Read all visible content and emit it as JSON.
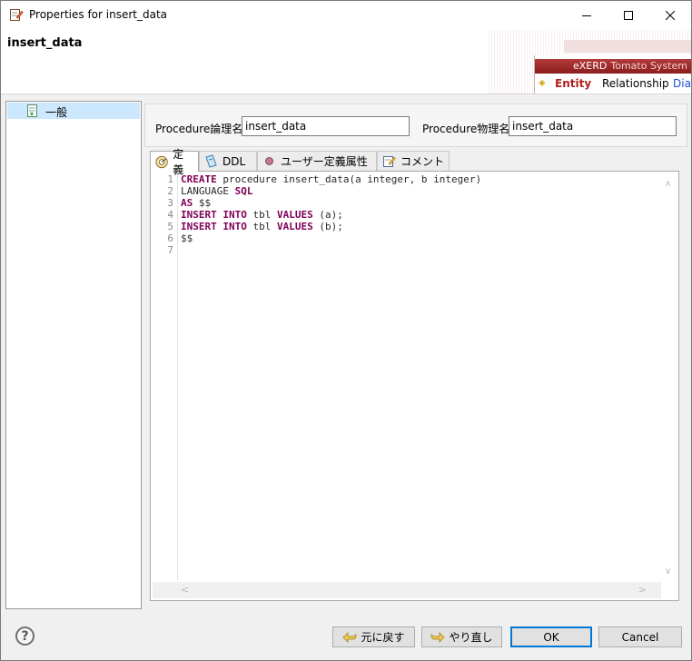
{
  "window": {
    "title": "Properties for insert_data"
  },
  "header": {
    "heading": "insert_data",
    "brand_name": "eXERD",
    "brand_sub": "Tomato System",
    "nav_entity": "Entity",
    "nav_relationship": "Relationship",
    "nav_diagram": "Diag"
  },
  "tree": {
    "items": [
      {
        "label": "一般"
      }
    ]
  },
  "fields": {
    "logical_label": "Procedure論理名",
    "logical_value": "insert_data",
    "physical_label": "Procedure物理名",
    "physical_value": "insert_data"
  },
  "tabs": [
    {
      "label": "定義",
      "icon": "definition-icon",
      "active": true
    },
    {
      "label": "DDL",
      "icon": "ddl-icon",
      "active": false
    },
    {
      "label": "ユーザー定義属性",
      "icon": "user-attribute-icon",
      "active": false
    },
    {
      "label": "コメント",
      "icon": "comment-icon",
      "active": false
    }
  ],
  "editor": {
    "line_numbers": [
      "1",
      "2",
      "3",
      "4",
      "5",
      "6",
      "7"
    ],
    "lines": [
      [
        {
          "t": "CREATE",
          "k": true
        },
        {
          "t": " procedure insert_data(a integer, b integer)",
          "k": false
        }
      ],
      [
        {
          "t": "LANGUAGE ",
          "k": false
        },
        {
          "t": "SQL",
          "k": true
        }
      ],
      [
        {
          "t": "AS",
          "k": true
        },
        {
          "t": " $$",
          "k": false
        }
      ],
      [
        {
          "t": "INSERT",
          "k": true
        },
        {
          "t": " ",
          "k": false
        },
        {
          "t": "INTO",
          "k": true
        },
        {
          "t": " tbl ",
          "k": false
        },
        {
          "t": "VALUES",
          "k": true
        },
        {
          "t": " (a);",
          "k": false
        }
      ],
      [
        {
          "t": "INSERT",
          "k": true
        },
        {
          "t": " ",
          "k": false
        },
        {
          "t": "INTO",
          "k": true
        },
        {
          "t": " tbl ",
          "k": false
        },
        {
          "t": "VALUES",
          "k": true
        },
        {
          "t": " (b);",
          "k": false
        }
      ],
      [
        {
          "t": "$$",
          "k": false
        }
      ],
      []
    ]
  },
  "footer": {
    "help_label": "?",
    "undo_label": "元に戻す",
    "redo_label": "やり直し",
    "ok_label": "OK",
    "cancel_label": "Cancel"
  },
  "colors": {
    "keyword": "#7f0055",
    "selection": "#cce8ff",
    "ok_border": "#0078d7",
    "brand_bar": "#8c1d1d"
  }
}
